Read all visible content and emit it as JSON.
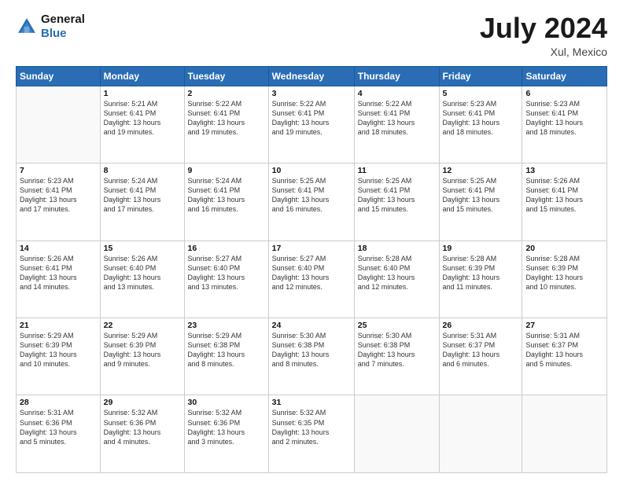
{
  "header": {
    "logo_line1": "General",
    "logo_line2": "Blue",
    "month_year": "July 2024",
    "location": "Xul, Mexico"
  },
  "weekdays": [
    "Sunday",
    "Monday",
    "Tuesday",
    "Wednesday",
    "Thursday",
    "Friday",
    "Saturday"
  ],
  "weeks": [
    [
      {
        "day": "",
        "info": ""
      },
      {
        "day": "1",
        "info": "Sunrise: 5:21 AM\nSunset: 6:41 PM\nDaylight: 13 hours\nand 19 minutes."
      },
      {
        "day": "2",
        "info": "Sunrise: 5:22 AM\nSunset: 6:41 PM\nDaylight: 13 hours\nand 19 minutes."
      },
      {
        "day": "3",
        "info": "Sunrise: 5:22 AM\nSunset: 6:41 PM\nDaylight: 13 hours\nand 19 minutes."
      },
      {
        "day": "4",
        "info": "Sunrise: 5:22 AM\nSunset: 6:41 PM\nDaylight: 13 hours\nand 18 minutes."
      },
      {
        "day": "5",
        "info": "Sunrise: 5:23 AM\nSunset: 6:41 PM\nDaylight: 13 hours\nand 18 minutes."
      },
      {
        "day": "6",
        "info": "Sunrise: 5:23 AM\nSunset: 6:41 PM\nDaylight: 13 hours\nand 18 minutes."
      }
    ],
    [
      {
        "day": "7",
        "info": "Sunrise: 5:23 AM\nSunset: 6:41 PM\nDaylight: 13 hours\nand 17 minutes."
      },
      {
        "day": "8",
        "info": "Sunrise: 5:24 AM\nSunset: 6:41 PM\nDaylight: 13 hours\nand 17 minutes."
      },
      {
        "day": "9",
        "info": "Sunrise: 5:24 AM\nSunset: 6:41 PM\nDaylight: 13 hours\nand 16 minutes."
      },
      {
        "day": "10",
        "info": "Sunrise: 5:25 AM\nSunset: 6:41 PM\nDaylight: 13 hours\nand 16 minutes."
      },
      {
        "day": "11",
        "info": "Sunrise: 5:25 AM\nSunset: 6:41 PM\nDaylight: 13 hours\nand 15 minutes."
      },
      {
        "day": "12",
        "info": "Sunrise: 5:25 AM\nSunset: 6:41 PM\nDaylight: 13 hours\nand 15 minutes."
      },
      {
        "day": "13",
        "info": "Sunrise: 5:26 AM\nSunset: 6:41 PM\nDaylight: 13 hours\nand 15 minutes."
      }
    ],
    [
      {
        "day": "14",
        "info": "Sunrise: 5:26 AM\nSunset: 6:41 PM\nDaylight: 13 hours\nand 14 minutes."
      },
      {
        "day": "15",
        "info": "Sunrise: 5:26 AM\nSunset: 6:40 PM\nDaylight: 13 hours\nand 13 minutes."
      },
      {
        "day": "16",
        "info": "Sunrise: 5:27 AM\nSunset: 6:40 PM\nDaylight: 13 hours\nand 13 minutes."
      },
      {
        "day": "17",
        "info": "Sunrise: 5:27 AM\nSunset: 6:40 PM\nDaylight: 13 hours\nand 12 minutes."
      },
      {
        "day": "18",
        "info": "Sunrise: 5:28 AM\nSunset: 6:40 PM\nDaylight: 13 hours\nand 12 minutes."
      },
      {
        "day": "19",
        "info": "Sunrise: 5:28 AM\nSunset: 6:39 PM\nDaylight: 13 hours\nand 11 minutes."
      },
      {
        "day": "20",
        "info": "Sunrise: 5:28 AM\nSunset: 6:39 PM\nDaylight: 13 hours\nand 10 minutes."
      }
    ],
    [
      {
        "day": "21",
        "info": "Sunrise: 5:29 AM\nSunset: 6:39 PM\nDaylight: 13 hours\nand 10 minutes."
      },
      {
        "day": "22",
        "info": "Sunrise: 5:29 AM\nSunset: 6:39 PM\nDaylight: 13 hours\nand 9 minutes."
      },
      {
        "day": "23",
        "info": "Sunrise: 5:29 AM\nSunset: 6:38 PM\nDaylight: 13 hours\nand 8 minutes."
      },
      {
        "day": "24",
        "info": "Sunrise: 5:30 AM\nSunset: 6:38 PM\nDaylight: 13 hours\nand 8 minutes."
      },
      {
        "day": "25",
        "info": "Sunrise: 5:30 AM\nSunset: 6:38 PM\nDaylight: 13 hours\nand 7 minutes."
      },
      {
        "day": "26",
        "info": "Sunrise: 5:31 AM\nSunset: 6:37 PM\nDaylight: 13 hours\nand 6 minutes."
      },
      {
        "day": "27",
        "info": "Sunrise: 5:31 AM\nSunset: 6:37 PM\nDaylight: 13 hours\nand 5 minutes."
      }
    ],
    [
      {
        "day": "28",
        "info": "Sunrise: 5:31 AM\nSunset: 6:36 PM\nDaylight: 13 hours\nand 5 minutes."
      },
      {
        "day": "29",
        "info": "Sunrise: 5:32 AM\nSunset: 6:36 PM\nDaylight: 13 hours\nand 4 minutes."
      },
      {
        "day": "30",
        "info": "Sunrise: 5:32 AM\nSunset: 6:36 PM\nDaylight: 13 hours\nand 3 minutes."
      },
      {
        "day": "31",
        "info": "Sunrise: 5:32 AM\nSunset: 6:35 PM\nDaylight: 13 hours\nand 2 minutes."
      },
      {
        "day": "",
        "info": ""
      },
      {
        "day": "",
        "info": ""
      },
      {
        "day": "",
        "info": ""
      }
    ]
  ]
}
